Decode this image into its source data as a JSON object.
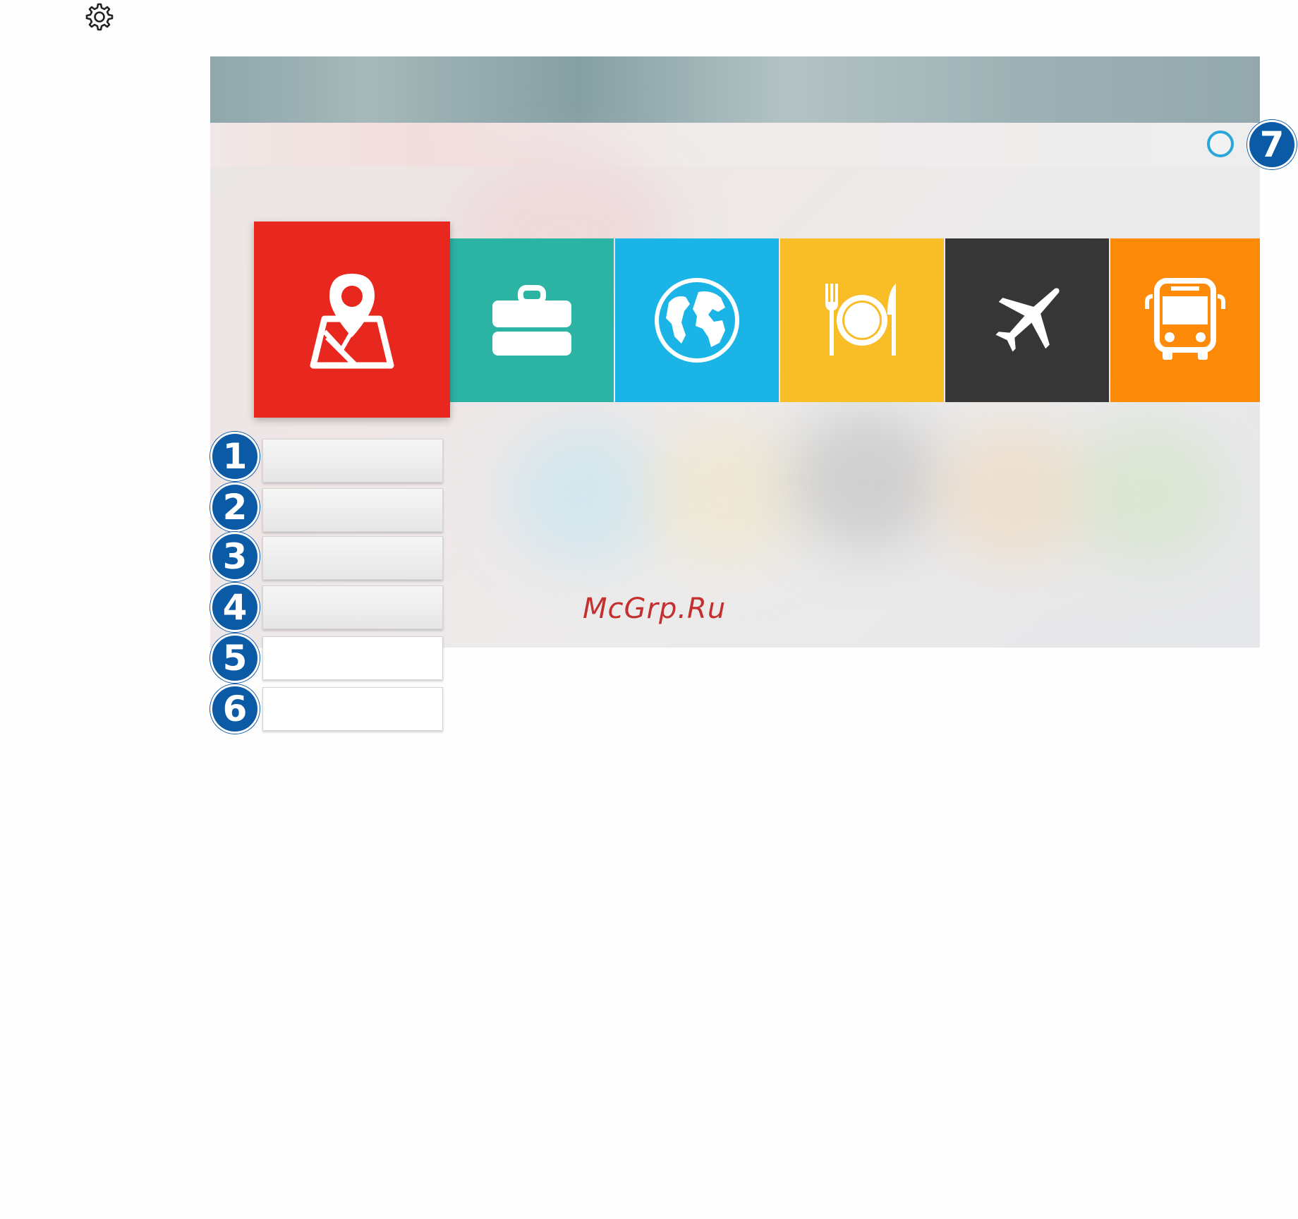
{
  "header": {
    "icon": "gear-icon"
  },
  "tiles": [
    {
      "name": "tile-map",
      "icon": "map-pin-icon",
      "color": "#e8281e",
      "focused": true
    },
    {
      "name": "tile-travel",
      "icon": "briefcase-icon",
      "color": "#2bb3a4"
    },
    {
      "name": "tile-world",
      "icon": "globe-icon",
      "color": "#1ab4e6"
    },
    {
      "name": "tile-food",
      "icon": "fork-knife-plate-icon",
      "color": "#f9bd28"
    },
    {
      "name": "tile-flight",
      "icon": "airplane-icon",
      "color": "#363636"
    },
    {
      "name": "tile-transport",
      "icon": "bus-icon",
      "color": "#fe8a0a"
    }
  ],
  "callouts": {
    "items": [
      "1",
      "2",
      "3",
      "4",
      "5",
      "6"
    ],
    "top_right": "7"
  },
  "colors": {
    "badge": "#0b5aa6",
    "ring": "#29a7d8"
  },
  "watermark": "McGrp.Ru"
}
